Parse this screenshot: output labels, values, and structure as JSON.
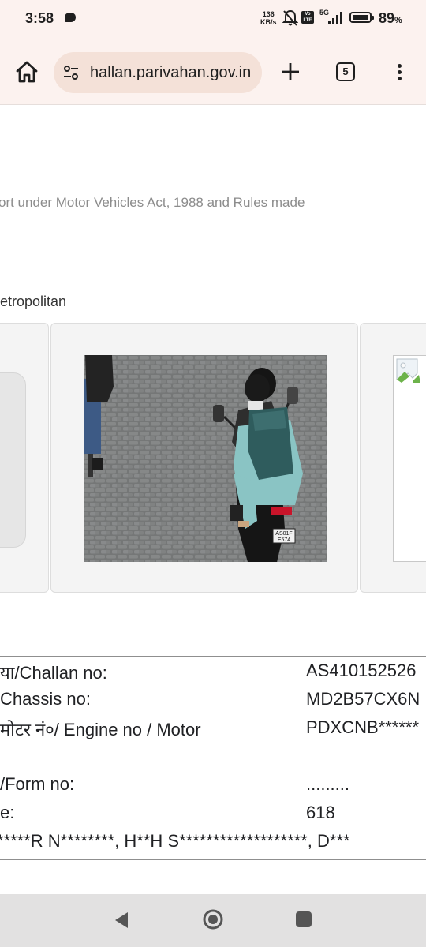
{
  "status_bar": {
    "time": "3:58",
    "net_speed_value": "136",
    "net_speed_unit": "KB/s",
    "volte_label": "Vo LTE",
    "network_type": "5G",
    "battery_percent": "89",
    "battery_percent_sign": "%",
    "battery_level": 0.89
  },
  "browser": {
    "url": "hallan.parivahan.gov.in",
    "tab_count": "5"
  },
  "page": {
    "intro_fragment": "ort under Motor Vehicles Act, 1988 and Rules made",
    "metro_fragment": "etropolitan",
    "photo_plate_text": "AS01F E574",
    "details": [
      {
        "label": "या/Challan no:",
        "value": "AS410152526"
      },
      {
        "label": " Chassis no:",
        "value": "MD2B57CX6N"
      },
      {
        "label": " मोटर नं०/ Engine no / Motor",
        "value": "PDXCNB******"
      },
      {
        "label": " /Form no:",
        "value": "........."
      },
      {
        "label": "e:",
        "value": "618"
      }
    ],
    "names_line": "*****R N********, H**H S*******************, D***"
  },
  "colors": {
    "chrome_bg": "#fcf2ef",
    "url_pill": "#f4e1d8",
    "nav_bar": "#e2e1e1"
  }
}
